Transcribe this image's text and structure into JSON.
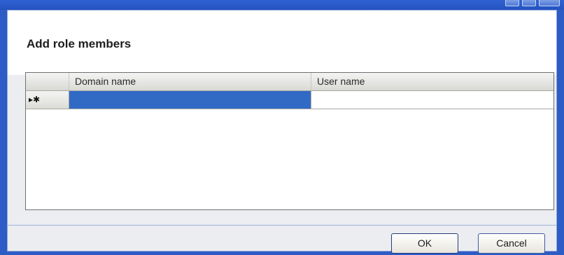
{
  "dialog": {
    "title": "Add role members"
  },
  "grid": {
    "columns": [
      "Domain name",
      "User name"
    ],
    "rows": [
      {
        "row_indicator": "▸✱",
        "domain_name": "",
        "user_name": ""
      }
    ]
  },
  "buttons": {
    "ok_label": "OK",
    "cancel_label": "Cancel"
  },
  "colors": {
    "selection": "#316ac5",
    "titlebar": "#2553c0",
    "dialog_bg": "#ecedf1"
  }
}
